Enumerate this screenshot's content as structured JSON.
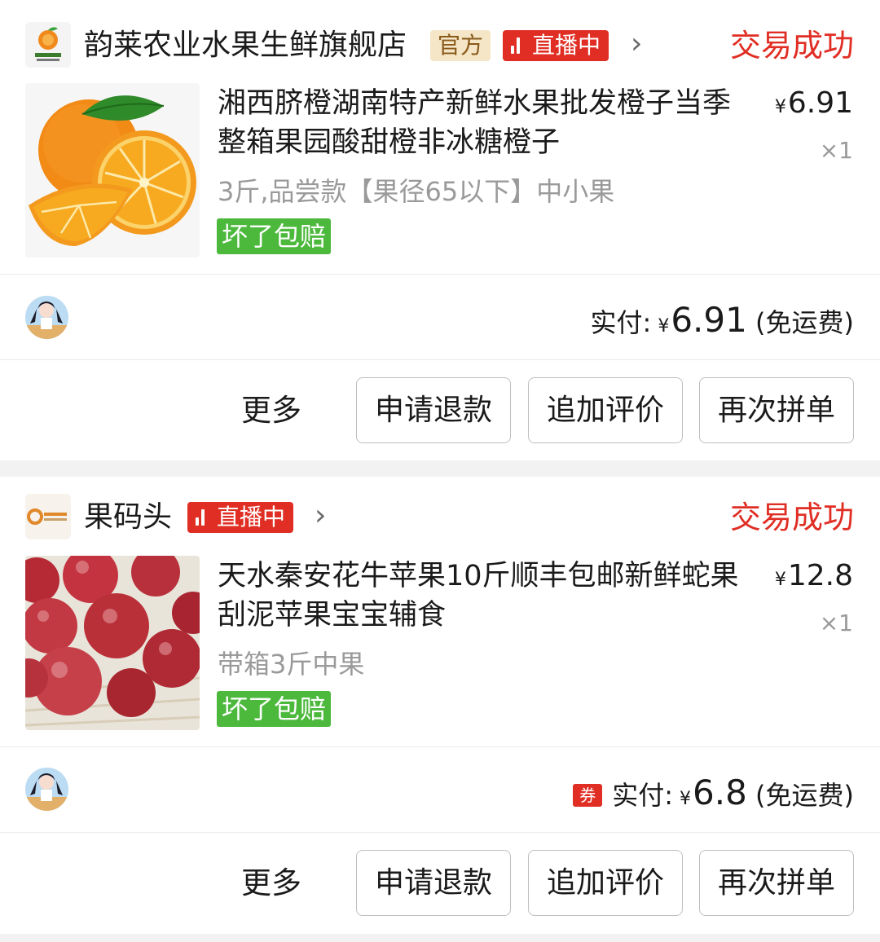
{
  "orders": [
    {
      "store": {
        "name": "韵莱农业水果生鲜旗舰店",
        "official_badge": "官方",
        "live_badge": "直播中",
        "chevron": "›",
        "logo_icon": "orange-store-logo-icon"
      },
      "status": "交易成功",
      "product": {
        "title": "湘西脐橙湖南特产新鲜水果批发橙子当季整箱果园酸甜橙非冰糖橙子",
        "sku": "3斤,品尝款【果径65以下】中小果",
        "guarantee": "坏了包赔",
        "currency": "¥",
        "price": "6.91",
        "qty": "×1",
        "image": "orange-product-image"
      },
      "payment": {
        "label": "实付:",
        "currency": "¥",
        "amount": "6.91",
        "shipping": "(免运费)"
      },
      "actions": {
        "more": "更多",
        "refund": "申请退款",
        "review": "追加评价",
        "regroup": "再次拼单"
      }
    },
    {
      "store": {
        "name": "果码头",
        "live_badge": "直播中",
        "chevron": "›",
        "logo_icon": "fruit-dock-store-logo-icon"
      },
      "status": "交易成功",
      "product": {
        "title": "天水秦安花牛苹果10斤顺丰包邮新鲜蛇果刮泥苹果宝宝辅食",
        "sku": "带箱3斤中果",
        "guarantee": "坏了包赔",
        "currency": "¥",
        "price": "12.8",
        "qty": "×1",
        "image": "apple-product-image"
      },
      "payment": {
        "coupon": "券",
        "label": "实付:",
        "currency": "¥",
        "amount": "6.8",
        "shipping": "(免运费)"
      },
      "actions": {
        "more": "更多",
        "refund": "申请退款",
        "review": "追加评价",
        "regroup": "再次拼单"
      }
    }
  ],
  "colors": {
    "accent_red": "#e02e24",
    "guarantee_green": "#4cb93d",
    "official_bg": "#f4e6c6",
    "page_bg": "#f2f2f2"
  }
}
